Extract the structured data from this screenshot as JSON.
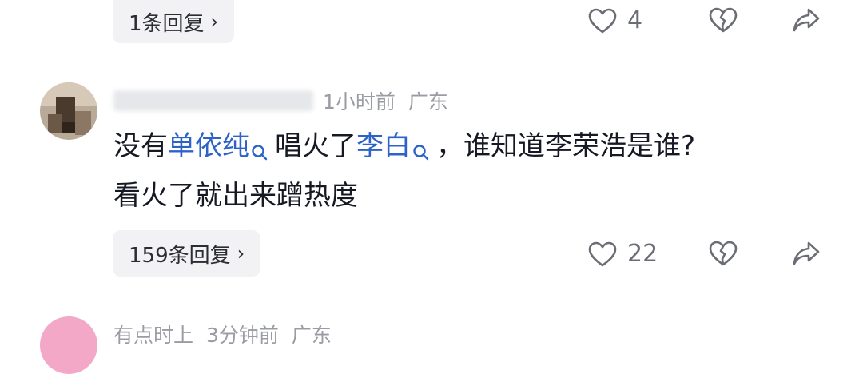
{
  "comment_top": {
    "reply_label": "1条回复",
    "like_count": "4"
  },
  "comment_main": {
    "username": "…",
    "time": "1小时前",
    "location": "广东",
    "text_part1": "没有",
    "link1": "单依纯",
    "text_part2": "唱火了",
    "link2": "李白",
    "text_part3": "，谁知道李荣浩是谁?",
    "text_line2": "看火了就出来蹭热度",
    "reply_label": "159条回复",
    "like_count": "22"
  },
  "comment_next": {
    "username": "有点时上",
    "time": "3分钟前",
    "location": "广东"
  },
  "icons": {
    "like": "heart-outline-icon",
    "dislike": "broken-heart-icon",
    "share": "share-arrow-icon",
    "chevron": "chevron-right-icon",
    "search": "search-icon"
  },
  "colors": {
    "link": "#2d63c8",
    "meta": "#9a9ca3",
    "pill_bg": "#f2f2f4"
  }
}
